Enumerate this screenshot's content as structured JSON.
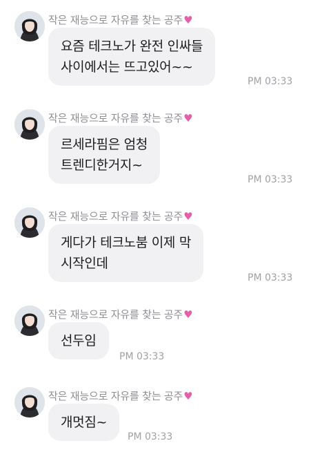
{
  "messages": [
    {
      "sender": "작은 재능으로 자유를 찾는 공주",
      "text": "요즘 테크노가 완전 인싸들\n사이에서는 뜨고있어~~",
      "time": "PM 03:33"
    },
    {
      "sender": "작은 재능으로 자유를 찾는 공주",
      "text": "르세라핌은 엄청\n트렌디한거지~",
      "time": "PM 03:33"
    },
    {
      "sender": "작은 재능으로 자유를 찾는 공주",
      "text": "게다가 테크노붐 이제 막\n시작인데",
      "time": "PM 03:33"
    },
    {
      "sender": "작은 재능으로 자유를 찾는 공주",
      "text": "선두임",
      "time": "PM 03:33"
    },
    {
      "sender": "작은 재능으로 자유를 찾는 공주",
      "text": "개멋짐~",
      "time": "PM 03:33"
    }
  ],
  "icons": {
    "sender_badge": "sparkling-heart-icon",
    "avatar": "profile-photo"
  },
  "colors": {
    "bubble": "#f1f1f4",
    "sender": "#8e8e93",
    "time": "#a0a0a6",
    "heart": "#e55fa8"
  }
}
